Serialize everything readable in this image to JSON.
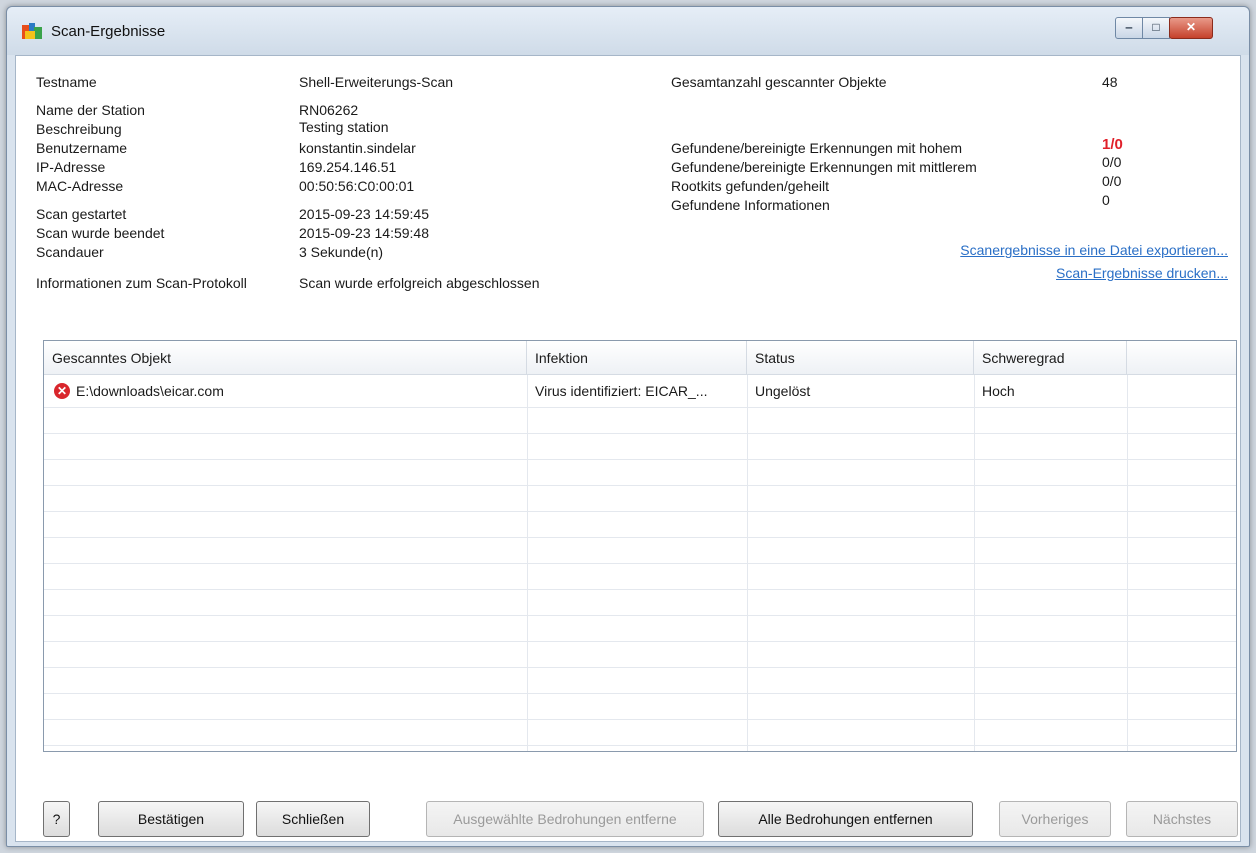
{
  "window": {
    "title": "Scan-Ergebnisse",
    "controls": {
      "minimize": "▭",
      "maximize": "□",
      "close": "✕"
    }
  },
  "info_left": [
    {
      "label": "Testname",
      "value": "Shell-Erweiterungs-Scan"
    },
    {
      "label": "Name der Station",
      "value": "RN06262"
    },
    {
      "label": "Beschreibung",
      "value": "Testing station"
    },
    {
      "label": "Benutzername",
      "value": "konstantin.sindelar"
    },
    {
      "label": "IP-Adresse",
      "value": "169.254.146.51"
    },
    {
      "label": "MAC-Adresse",
      "value": "00:50:56:C0:00:01"
    },
    {
      "label": "Scan gestartet",
      "value": "2015-09-23 14:59:45"
    },
    {
      "label": "Scan wurde beendet",
      "value": "2015-09-23 14:59:48"
    },
    {
      "label": "Scandauer",
      "value": "3 Sekunde(n)"
    },
    {
      "label": "Informationen zum Scan-Protokoll",
      "value": "Scan wurde erfolgreich abgeschlossen"
    }
  ],
  "info_right": [
    {
      "label": "Gesamtanzahl gescannter Objekte",
      "value": "48"
    },
    {
      "label": "Gefundene/bereinigte Erkennungen mit hohem",
      "value": "1/0"
    },
    {
      "label": "Gefundene/bereinigte Erkennungen mit mittlerem",
      "value": "0/0"
    },
    {
      "label": "Rootkits gefunden/geheilt",
      "value": "0/0"
    },
    {
      "label": "Gefundene Informationen",
      "value": "0"
    }
  ],
  "links": {
    "export": "Scanergebnisse in eine Datei exportieren...",
    "print": "Scan-Ergebnisse drucken..."
  },
  "table": {
    "columns": [
      "Gescanntes Objekt",
      "Infektion",
      "Status",
      "Schweregrad"
    ],
    "rows": [
      {
        "icon": "error-icon",
        "object": "E:\\downloads\\eicar.com",
        "infection": "Virus identifiziert: EICAR_...",
        "status": "Ungelöst",
        "severity": "Hoch"
      }
    ]
  },
  "buttons": {
    "help": "?",
    "confirm": "Bestätigen",
    "close": "Schließen",
    "remove_selected": "Ausgewählte Bedrohungen entferne",
    "remove_all": "Alle Bedrohungen entfernen",
    "previous": "Vorheriges",
    "next": "Nächstes"
  },
  "colors": {
    "accent_red": "#e0202a",
    "link": "#2a6fc6"
  }
}
